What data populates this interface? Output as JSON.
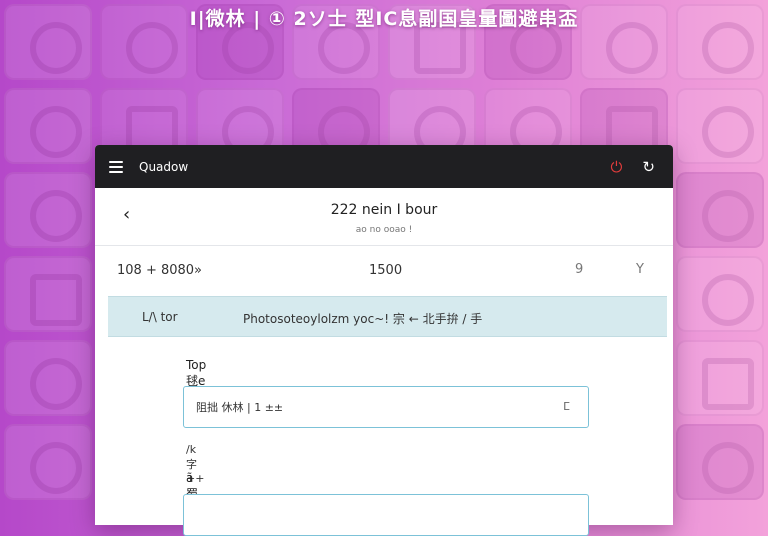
{
  "banner": {
    "text": "I|微林 | ① 2ソ士 型IC息副国皇量圖避串盃"
  },
  "window": {
    "app_title": "Quadow",
    "header": {
      "title": "222 nein I bour",
      "subtitle": "ao no ooao      !"
    },
    "stats": {
      "left": "108 + 8080»",
      "center": "1500",
      "icon_a": "9",
      "icon_b": "Y"
    },
    "strip": {
      "label": "L/\\ tor",
      "text": "Photosoteoylolzm yoc~! 宗 ← 北手拚 / 手"
    },
    "form": {
      "field1_label": "Top 毬e 取Stt",
      "field1_value": "阻拙 休林 | 1 ±±",
      "field1_icon": "ⵎ",
      "hint": "/k 字++",
      "field2_label": "ã蜀越|卅",
      "field2_value": ""
    }
  },
  "colors": {
    "titlebar": "#1f1f22",
    "strip": "#d6eaee",
    "field_border": "#7cc2d8",
    "power": "#e23c3c"
  }
}
